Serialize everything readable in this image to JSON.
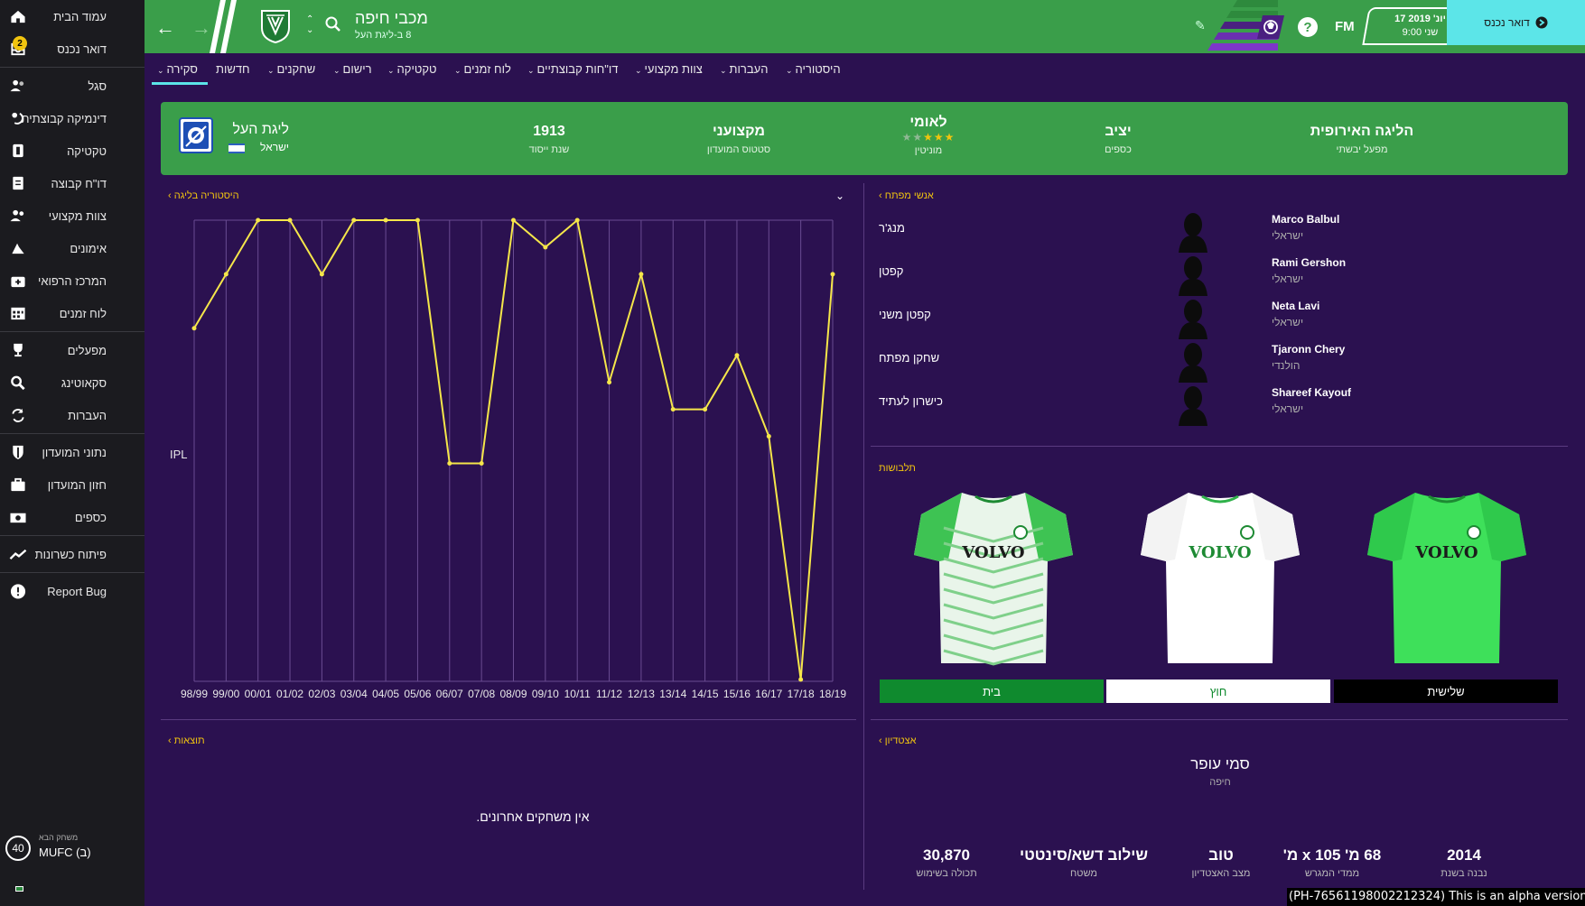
{
  "sidebar": {
    "items": [
      {
        "label": "עמוד הבית",
        "icon": "home-icon"
      },
      {
        "label": "דואר נכנס",
        "icon": "inbox-icon",
        "badge": "2"
      },
      {
        "label": "סגל",
        "icon": "squad-icon"
      },
      {
        "label": "דינמיקה קבוצתית",
        "icon": "dynamics-icon"
      },
      {
        "label": "טקטיקה",
        "icon": "tactics-icon"
      },
      {
        "label": "דו\"ח קבוצה",
        "icon": "report-icon"
      },
      {
        "label": "צוות מקצועי",
        "icon": "staff-icon"
      },
      {
        "label": "אימונים",
        "icon": "training-icon"
      },
      {
        "label": "המרכז הרפואי",
        "icon": "medical-icon"
      },
      {
        "label": "לוח זמנים",
        "icon": "calendar-icon"
      },
      {
        "label": "מפעלים",
        "icon": "trophy-icon"
      },
      {
        "label": "סקאוטינג",
        "icon": "scouting-icon"
      },
      {
        "label": "העברות",
        "icon": "transfers-icon"
      },
      {
        "label": "נתוני המועדון",
        "icon": "shield-icon"
      },
      {
        "label": "חזון המועדון",
        "icon": "briefcase-icon"
      },
      {
        "label": "כספים",
        "icon": "finance-icon"
      },
      {
        "label": "פיתוח כשרונות",
        "icon": "development-icon"
      },
      {
        "label": "Report Bug",
        "icon": "bug-icon"
      }
    ],
    "next_match": {
      "small": "משחק הבא",
      "team": "MUFC (ב)",
      "number": "40"
    }
  },
  "topbar": {
    "club_name": "מכבי חיפה",
    "club_sub": "8 ב-ליגת העל",
    "fm": "FM",
    "help": "?",
    "date_line1": "17 יונ' 2019",
    "date_line2": "9:00 שני",
    "inbox_label": "דואר נכנס",
    "accent": "#3a9e4a",
    "inbox_color": "#5ce5e8"
  },
  "tabs": [
    {
      "label": "סקירה",
      "chev": true
    },
    {
      "label": "חדשות",
      "chev": false
    },
    {
      "label": "שחקנים",
      "chev": true
    },
    {
      "label": "רישום",
      "chev": true
    },
    {
      "label": "טקטיקה",
      "chev": true
    },
    {
      "label": "לוח זמנים",
      "chev": true
    },
    {
      "label": "דו\"חות קבוצתיים",
      "chev": true
    },
    {
      "label": "צוות מקצועי",
      "chev": true
    },
    {
      "label": "העברות",
      "chev": true
    },
    {
      "label": "היסטוריה",
      "chev": true
    }
  ],
  "info": {
    "competition": {
      "name": "ליגת העל",
      "country": "ישראל"
    },
    "founded": {
      "value": "1913",
      "label": "שנת ייסוד"
    },
    "status": {
      "value": "מקצועני",
      "label": "סטטוס המועדון"
    },
    "reputation": {
      "value": "לאומי",
      "label": "מוניטין",
      "stars": 3,
      "max_stars": 5
    },
    "finances": {
      "value": "יציב",
      "label": "כספים"
    },
    "european": {
      "value": "הליגה האירופית",
      "label": "מפעל יבשתי"
    }
  },
  "league_history": {
    "link": "היסטוריה בליגה",
    "collapse": "⌄"
  },
  "chart_data": {
    "type": "line",
    "title": "",
    "ylabel": "IPL",
    "xlabel": "",
    "categories": [
      "98/99",
      "99/00",
      "00/01",
      "01/02",
      "02/03",
      "03/04",
      "04/05",
      "05/06",
      "06/07",
      "07/08",
      "08/09",
      "09/10",
      "10/11",
      "11/12",
      "12/13",
      "13/14",
      "14/15",
      "15/16",
      "16/17",
      "17/18",
      "18/19"
    ],
    "series": [
      {
        "values": [
          5,
          3,
          1,
          1,
          3,
          1,
          1,
          1,
          10,
          10,
          1,
          2,
          1,
          7,
          3,
          8,
          8,
          6,
          9,
          18,
          3
        ]
      }
    ],
    "ylim": [
      1,
      18
    ],
    "inverted": true,
    "grid": true,
    "line_color": "#f5e64a"
  },
  "key_people": {
    "link": "אנשי מפתח",
    "people": [
      {
        "role": "מנג'ר",
        "name": "Marco Balbul",
        "nationality": "ישראלי"
      },
      {
        "role": "קפטן",
        "name": "Rami Gershon",
        "nationality": "ישראלי"
      },
      {
        "role": "קפטן משני",
        "name": "Neta Lavi",
        "nationality": "ישראלי"
      },
      {
        "role": "שחקן מפתח",
        "name": "Tjaronn Chery",
        "nationality": "הולנדי"
      },
      {
        "role": "כישרון לעתיד",
        "name": "Shareef Kayouf",
        "nationality": "ישראלי"
      }
    ]
  },
  "kits": {
    "label": "תלבושות",
    "sponsor": "VOLVO",
    "items": [
      {
        "label": "בית",
        "bar_bg": "#0f8a2e",
        "bar_fg": "#ffffff"
      },
      {
        "label": "חוץ",
        "bar_bg": "#ffffff",
        "bar_fg": "#0f8a2e"
      },
      {
        "label": "שלישית",
        "bar_bg": "#000000",
        "bar_fg": "#ffffff"
      }
    ]
  },
  "results": {
    "link": "תוצאות",
    "empty": "אין משחקים אחרונים."
  },
  "stadium": {
    "link": "אצטדיון",
    "name": "סמי עופר",
    "city": "חיפה",
    "stats": [
      {
        "value": "2014",
        "label": "נבנה בשנת"
      },
      {
        "value": "68 מ' x 105 מ'",
        "label": "ממדי המגרש"
      },
      {
        "value": "טוב",
        "label": "מצב האצטדיון"
      },
      {
        "value": "שילוב דשא/סינטטי",
        "label": "משטח"
      },
      {
        "value": "30,870",
        "label": "תכולה בשימוש"
      }
    ]
  },
  "alpha": "(PH-76561198002212324) This is an alpha version"
}
